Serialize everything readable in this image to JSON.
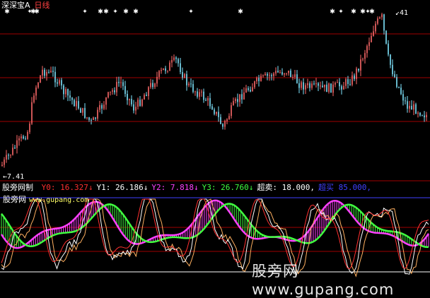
{
  "header": {
    "app_name": "深深宝A",
    "period": "日线"
  },
  "price_panel": {
    "high_label": "41",
    "low_label": "7.41",
    "signal_count": 14
  },
  "indicator": {
    "name": "股旁网制",
    "fields": [
      {
        "label": "Y0:",
        "value": "16.327",
        "arrow": "↓",
        "color": "#ff3030"
      },
      {
        "label": "Y1:",
        "value": "26.186",
        "arrow": "↓",
        "color": "#ffffff"
      },
      {
        "label": "Y2:",
        "value": "7.818",
        "arrow": "↓",
        "color": "#ff40ff"
      },
      {
        "label": "Y3:",
        "value": "26.760",
        "arrow": "↓",
        "color": "#40ff40"
      },
      {
        "label": "超卖:",
        "value": "18.000,",
        "arrow": "",
        "color": "#ffffff"
      },
      {
        "label": "超买",
        "value": "85.000,",
        "arrow": "",
        "color": "#4040ff"
      }
    ],
    "site_name": "股旁网",
    "site_url": "www.gupang.com"
  },
  "watermark": "股旁网 www.gupang.com",
  "colors": {
    "up": "#ff6a6a",
    "down": "#7fe6ff",
    "grid": "#a00000",
    "magenta": "#ff40ff",
    "green": "#40ff40",
    "line1": "#ffffff",
    "line2": "#ffb060",
    "overbought": "#4040ff"
  }
}
